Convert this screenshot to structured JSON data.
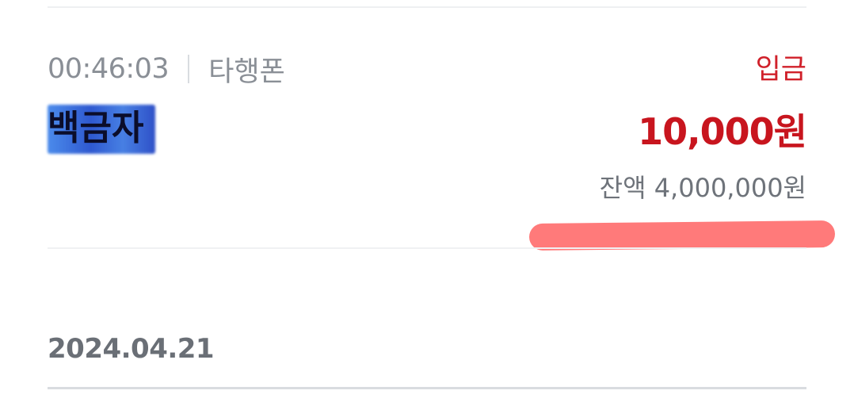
{
  "transaction": {
    "time": "00:46:03",
    "channel": "타행폰",
    "type": "입금",
    "name": "백금자",
    "amount": "10,000원",
    "balance": "잔액 4,000,000원"
  },
  "date_header": {
    "date": "2024.04.21"
  },
  "colors": {
    "accent_red": "#c8151e",
    "secondary_gray": "#8a8f96",
    "redaction_blue": "#0a3cc8",
    "highlight_red": "#ff7a7a"
  }
}
